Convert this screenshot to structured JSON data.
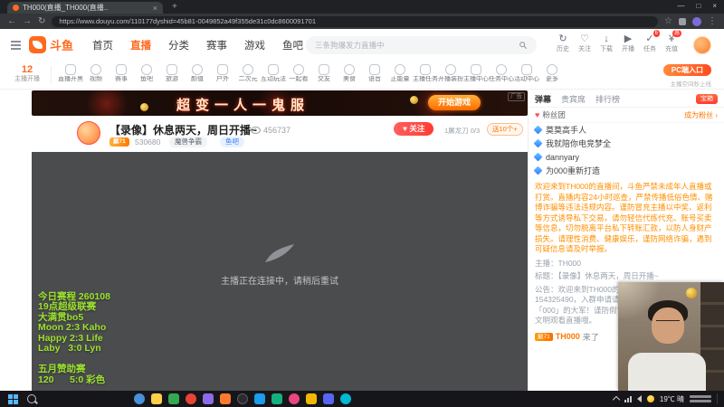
{
  "browser": {
    "tab_title": "TH000(直播_TH000(直播..",
    "close": "×",
    "new_tab": "+",
    "min": "—",
    "max": "□",
    "back": "←",
    "forward": "→",
    "reload": "↻",
    "url": "https://www.douyu.com/110177dyshid=45b81-0049852a49f355de31c0dc8600091701",
    "star": "☆",
    "menu": "⋮"
  },
  "header": {
    "brand": "斗鱼",
    "nav": [
      "首页",
      "直播",
      "分类",
      "赛事",
      "游戏",
      "鱼吧"
    ],
    "search_placeholder": "三条狗爆发力直播中",
    "icons": [
      {
        "glyph": "↻",
        "label": "历史"
      },
      {
        "glyph": "♡",
        "label": "关注"
      },
      {
        "glyph": "↓",
        "label": "下载"
      },
      {
        "glyph": "▶",
        "label": "开播"
      },
      {
        "glyph": "✓",
        "label": "任务",
        "badge": "6"
      },
      {
        "glyph": "¥",
        "label": "充值",
        "badge": "惠"
      }
    ]
  },
  "feature_bar": {
    "count": "12",
    "count_label": "主播开播",
    "items": [
      "直播开黑",
      "视频",
      "赛事",
      "鱼吧",
      "旅游",
      "颜值",
      "户外",
      "二次元",
      "互动玩法",
      "一起看",
      "交友",
      "美食",
      "语音",
      "正能量",
      "主播任务",
      "开播装扮",
      "主播中心",
      "任务中心",
      "活动中心",
      "更多"
    ],
    "pc_button": "PC端入口",
    "pc_caption": "主播空间秒上线"
  },
  "banner": {
    "title": "超变一人一鬼服",
    "play_button": "开始游戏",
    "ad_tag": "广告"
  },
  "stream": {
    "title": "【录像】休息两天，周日开播~",
    "viewers": "456737",
    "follow_button": "♥ 关注",
    "weekly_widget": "1屠龙刀 0/3",
    "gift_bubble": "送10个+",
    "level_badge": "巅71",
    "followers": "530680",
    "category": "魔兽争霸",
    "tag": "鱼吧",
    "loading_text": "主播正在连接中，请稍后重试",
    "schedule_lines": [
      "今日赛程 260108",
      "19点超级联赛",
      "大满贯bo5",
      "Moon 2:3 Kaho",
      "Happy 2:3 Life",
      "Laby   3:0 Lyn",
      "",
      "五月赞助赛",
      "120      5:0 彩色"
    ]
  },
  "sidebar": {
    "tabs": [
      "弹幕",
      "贵宾席",
      "排行榜"
    ],
    "chest": "宝箱",
    "fan_label": "粉丝团",
    "fan_action": "成为粉丝 ›",
    "vip_list": [
      "莫莫高手人",
      "我就陪你电竞梦全",
      "dannyary",
      "为000重新打造"
    ],
    "notice": "欢迎来到TH000的直播间，斗鱼严禁未成年人直播或打赏。直播内容24小时巡查，严禁传播低俗色情、赌博诈骗等违法违规内容。谨防冒充主播以中奖、返利等方式诱导私下交易，请勿轻信代练代充、账号买卖等信息，切勿脱离平台私下转账汇款，以防人身财产损失。请理性消费、健康娱乐，谨防网络诈骗，遇到可疑信息请及时举报。",
    "info_host": "主播：TH000",
    "info_title": "标题：【录像】休息两天，周日开播~",
    "info_notice": "公告：欢迎来到TH000的直播间！房管QQ群：154325490，入群申请请注明斗鱼ID~ 请不要相信带「000」的大军！谨防假冒、代打、代练等广告信息，文明观看直播哦。",
    "join_badge": "巅71",
    "join_name": "TH000",
    "join_text": "来了"
  },
  "taskbar": {
    "weather": "19℃ 晴"
  }
}
